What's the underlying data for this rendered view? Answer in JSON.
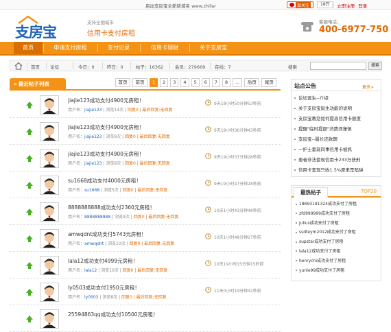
{
  "topbar": {
    "notice": "启动支房宝全新新域名 www.zhifar",
    "weibo_follow": "加关注",
    "fans": "18万",
    "login": "登录",
    "register": "立即注册",
    "sep": "|"
  },
  "header": {
    "logo_text": "支房宝",
    "slogan_line1": "支持全国城市",
    "slogan_line2": "信用卡支付房租",
    "phone_label": "客服电话：",
    "phone_number": "400-6977-750"
  },
  "nav": {
    "items": [
      {
        "label": "首页"
      },
      {
        "label": "申请支付房租"
      },
      {
        "label": "支付记录"
      },
      {
        "label": "信用卡理财"
      },
      {
        "label": "关于支房宝"
      }
    ]
  },
  "crumb": {
    "home": "首页",
    "forum": "论坛",
    "today": "今日：0",
    "yesterday": "昨日：0",
    "posts": "帖子：16362",
    "members": "会员：279669",
    "online": "在线：7",
    "search_label": "搜索",
    "search_button": "搜索",
    "search_value": ""
  },
  "list": {
    "heading": "最近帖子列表",
    "pager": [
      "首页",
      "前页",
      "1",
      "2",
      "3",
      "4",
      "5",
      "6",
      "7",
      "8",
      "...",
      "后页",
      "尾页"
    ],
    "current_page": "1"
  },
  "posts": [
    {
      "title": "jiajie123成功支付4900元房租！",
      "user_prefix": "用户名：",
      "user": "jiajie123",
      "views": " | 浏览14次 | ",
      "reply": "回复0 | 最后回复:无回复",
      "time": "9天18小时50分钟53秒前"
    },
    {
      "title": "jiajie123成功支付4900元房租！",
      "user_prefix": "用户名：",
      "user": "jiajie123",
      "views": " | 浏览9次 | ",
      "reply": "回复0 | 最后回复:无回复",
      "time": "9天19小时36分钟43秒前"
    },
    {
      "title": "jiajie123成功支付4900元房租！",
      "user_prefix": "用户名：",
      "user": "jiajie123",
      "views": " | 浏览8次 | ",
      "reply": "回复0 | 最后回复:无回复",
      "time": "9天19小时37分钟28秒前"
    },
    {
      "title": "su1668成功支付4000元房租！",
      "user_prefix": "用户名：",
      "user": "su1668",
      "views": " | 浏览5次 | ",
      "reply": "回复0 | 最后回复:无回复",
      "time": "9天19小时47分钟28秒前"
    },
    {
      "title": "8888888888成功支付2360元房租！",
      "user_prefix": "用户名：",
      "user": "8888888888",
      "views": " | 浏览9次 | ",
      "reply": "回复0 | 最后回复:无回复",
      "time": "10天1小时43分钟48秒前"
    },
    {
      "title": "amwqdnt成功支付5743元房租！",
      "user_prefix": "用户名：",
      "user": "amwqdnt",
      "views": " | 浏览10次 | ",
      "reply": "回复0 | 最后回复:无回复",
      "time": "10天1小时48分钟27秒前"
    },
    {
      "title": "lala12成功支付4999元房租！",
      "user_prefix": "用户名：",
      "user": "lala12",
      "views": " | 浏览10次 | ",
      "reply": "回复0 | 最后回复:无回复",
      "time": "10天19小时15分钟15秒前"
    },
    {
      "title": "ly0503成功支付1950元房租！",
      "user_prefix": "用户名：",
      "user": "ly0503",
      "views": " | 浏览8次 | ",
      "reply": "回复0 | 最后回复:无回复",
      "time": "11天0小时19分钟32秒前"
    },
    {
      "title": "25594863qq成功支付10500元房租！",
      "user_prefix": "",
      "user": "",
      "views": "",
      "reply": "",
      "time": ""
    }
  ],
  "announce": {
    "title": "站点公告",
    "more": "更多>",
    "items": [
      "论坛诞生--介绍",
      "关于支房宝诞生功能的说明",
      "支房宝教您如何提高信用卡额度",
      "提醒\"临时提额\"消费须谨慎",
      "支房宝--最长还款期",
      "一护士套现同事信用卡被抓",
      "患者非法套现信用卡233万获刑",
      "信用卡套现只收1.5%原来是陷阱"
    ]
  },
  "hot": {
    "title": "最热帖子",
    "top10": "TOP10",
    "items": [
      "18693191324成功支付了房租",
      "zfd999999成功支付了房租",
      "julius成功支付了房租",
      "ssdteym2012成功支付了房租",
      "supstar成功支付了房租",
      "lala12成功支付了房租",
      "henrychi成功支付了房租",
      "yunle99成功支付了房租"
    ]
  },
  "colors": {
    "accent": "#f39215",
    "brand_blue": "#1d62b9",
    "phone_orange": "#e26a00"
  }
}
